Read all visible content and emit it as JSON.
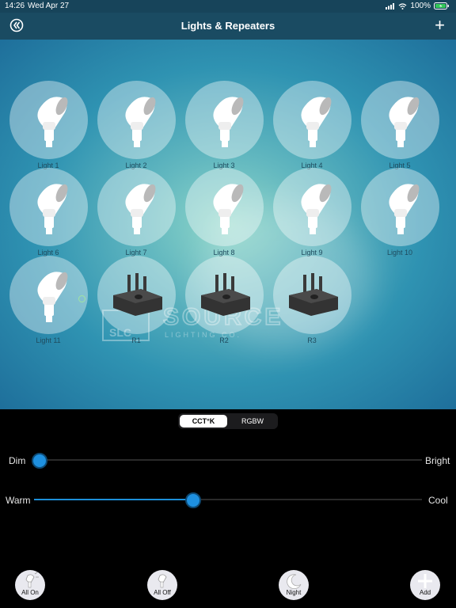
{
  "status_bar": {
    "time": "14:26",
    "date": "Wed Apr 27",
    "battery": "100%"
  },
  "navbar": {
    "title": "Lights & Repeaters"
  },
  "watermark": {
    "text": "SOURCE",
    "subtitle": "LIGHTING CO."
  },
  "devices": [
    {
      "label": "Light  1",
      "kind": "light"
    },
    {
      "label": "Light  2",
      "kind": "light"
    },
    {
      "label": "Light  3",
      "kind": "light"
    },
    {
      "label": "Light  4",
      "kind": "light"
    },
    {
      "label": "Light  5",
      "kind": "light"
    },
    {
      "label": "Light  6",
      "kind": "light"
    },
    {
      "label": "Light  7",
      "kind": "light"
    },
    {
      "label": "Light  8",
      "kind": "light"
    },
    {
      "label": "Light  9",
      "kind": "light"
    },
    {
      "label": "Light 10",
      "kind": "light"
    },
    {
      "label": "Light 11",
      "kind": "light"
    },
    {
      "label": "R1",
      "kind": "repeater"
    },
    {
      "label": "R2",
      "kind": "repeater"
    },
    {
      "label": "R3",
      "kind": "repeater"
    }
  ],
  "mode_tabs": {
    "active": "CCT°K",
    "inactive": "RGBW"
  },
  "sliders": {
    "brightness": {
      "min_label": "Dim",
      "max_label": "Bright",
      "value": 0.0
    },
    "temperature": {
      "min_label": "Warm",
      "max_label": "Cool",
      "value": 0.41
    }
  },
  "buttons": [
    {
      "label": "All On",
      "icon": "light-on-icon"
    },
    {
      "label": "All Off",
      "icon": "light-off-icon"
    },
    {
      "label": "Night",
      "icon": "moon-icon"
    },
    {
      "label": "Add",
      "icon": "plus-icon"
    }
  ],
  "colors": {
    "accent": "#1e90e0",
    "navbar": "#1a4b62"
  }
}
